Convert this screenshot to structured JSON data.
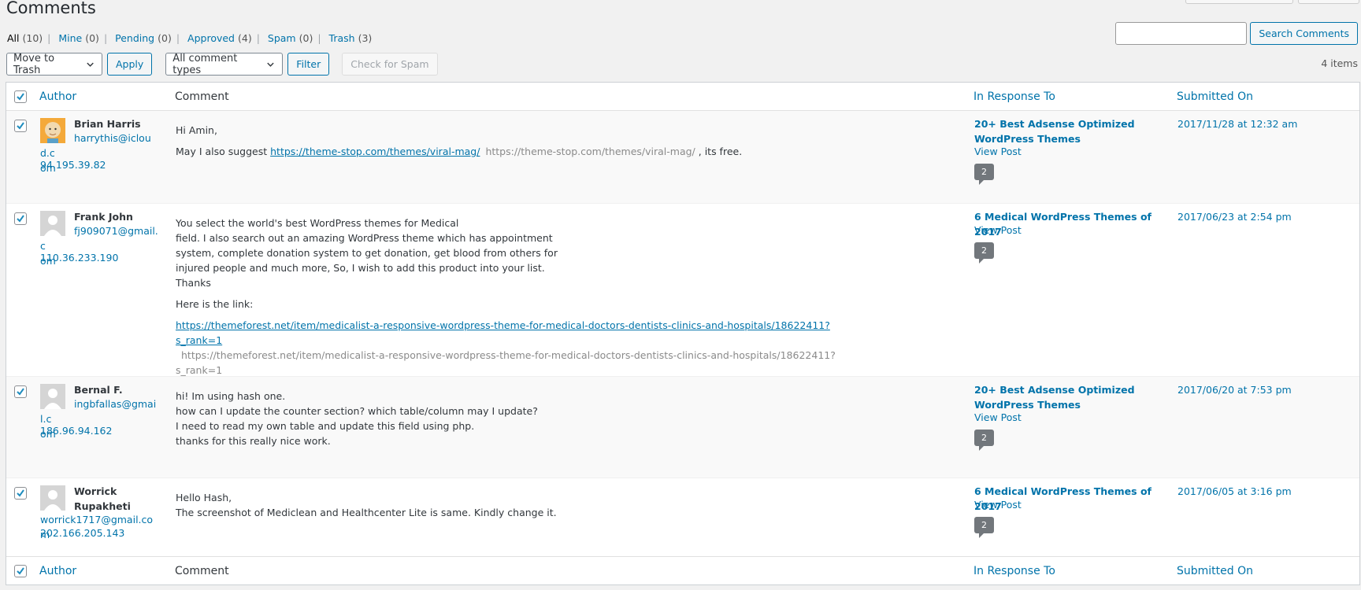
{
  "page": {
    "title": "Comments",
    "search_button": "Search Comments",
    "search_placeholder": "",
    "items_count": "4 items"
  },
  "filters": [
    {
      "label": "All",
      "count": "(10)"
    },
    {
      "label": "Mine",
      "count": "(0)"
    },
    {
      "label": "Pending",
      "count": "(0)"
    },
    {
      "label": "Approved",
      "count": "(4)"
    },
    {
      "label": "Spam",
      "count": "(0)"
    },
    {
      "label": "Trash",
      "count": "(3)"
    }
  ],
  "tablenav": {
    "bulk_action": "Move to Trash",
    "apply": "Apply",
    "comment_type": "All comment types",
    "filter": "Filter",
    "check_spam": "Check for Spam"
  },
  "columns": {
    "author": "Author",
    "comment": "Comment",
    "response": "In Response To",
    "submitted": "Submitted On"
  },
  "rows": [
    {
      "name": "Brian Harris",
      "email_1": "harrythis@icloud.c",
      "email_2": "om",
      "ip": "94.195.39.82",
      "line_1": "Hi Amin,",
      "line_2_pre": "May I also suggest ",
      "link_1": "https://theme-stop.com/themes/viral-mag/",
      "link_1_plain": "https://theme-stop.com/themes/viral-mag/",
      "line_2_post": " , its free.",
      "response": "20+ Best Adsense Optimized WordPress Themes",
      "view_post": "View Post",
      "count": "2",
      "submitted": "2017/11/28 at 12:32 am"
    },
    {
      "name": "Frank John",
      "email_1": "fj909071@gmail.c",
      "email_2": "om",
      "ip": "110.36.233.190",
      "p1_l1": "You select the world's best WordPress themes for Medical",
      "p1_l2": "field. I also search out an amazing WordPress theme which has appointment",
      "p1_l3": "system, complete donation system to get donation, get blood from others for",
      "p1_l4": "injured people and much more, So, I wish to add this product into your list.",
      "p1_l5": "Thanks",
      "p2": "Here is the link:",
      "link": "https://themeforest.net/item/medicalist-a-responsive-wordpress-theme-for-medical-doctors-dentists-clinics-and-hospitals/18622411?s_rank=1",
      "link_plain": "https://themeforest.net/item/medicalist-a-responsive-wordpress-theme-for-medical-doctors-dentists-clinics-and-hospitals/18622411?s_rank=1",
      "response": "6 Medical WordPress Themes of 2017",
      "view_post": "View Post",
      "count": "2",
      "submitted": "2017/06/23 at 2:54 pm"
    },
    {
      "name": "Bernal F.",
      "email_1": "ingbfallas@gmail.c",
      "email_2": "om",
      "ip": "186.96.94.162",
      "l1": "hi! Im using hash one.",
      "l2": "how can I update the counter section? which table/column may I update?",
      "l3": "I need to read my own table and update this field using php.",
      "l4": "thanks for this really nice work.",
      "response": "20+ Best Adsense Optimized WordPress Themes",
      "view_post": "View Post",
      "count": "2",
      "submitted": "2017/06/20 at 7:53 pm"
    },
    {
      "name": "Worrick Rupakheti",
      "email_1": "worrick1717@gmail.com",
      "ip": "202.166.205.143",
      "l1": "Hello Hash,",
      "l2": "The screenshot of Mediclean and Healthcenter Lite is same. Kindly change it.",
      "response": "6 Medical WordPress Themes of 2017",
      "view_post": "View Post",
      "count": "2",
      "submitted": "2017/06/05 at 3:16 pm"
    }
  ],
  "icons": {
    "checkbox": "checkmark-icon",
    "dropdown": "chevron-down-icon",
    "avatar_default": "default-avatar-icon",
    "avatar_custom": "cartoon-avatar-icon",
    "comment_count": "comment-bubble-icon"
  },
  "colors": {
    "link": "#0073aa",
    "background": "#f1f1f1",
    "bubble": "#72777c"
  }
}
